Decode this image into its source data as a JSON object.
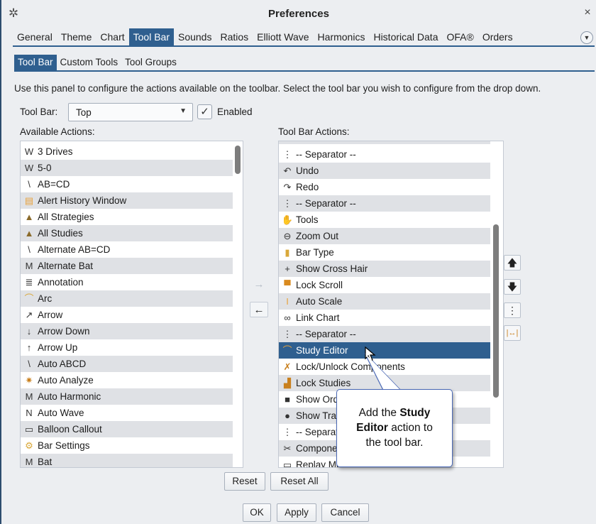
{
  "window": {
    "title": "Preferences",
    "gear_icon": "gear-icon",
    "close_glyph": "×"
  },
  "tabs": [
    {
      "label": "General"
    },
    {
      "label": "Theme"
    },
    {
      "label": "Chart"
    },
    {
      "label": "Tool Bar",
      "active": true
    },
    {
      "label": "Sounds"
    },
    {
      "label": "Ratios"
    },
    {
      "label": "Elliott Wave"
    },
    {
      "label": "Harmonics"
    },
    {
      "label": "Historical Data"
    },
    {
      "label": "OFA®"
    },
    {
      "label": "Orders"
    }
  ],
  "subtabs": [
    {
      "label": "Tool Bar",
      "active": true
    },
    {
      "label": "Custom Tools"
    },
    {
      "label": "Tool Groups"
    }
  ],
  "description": "Use this panel to configure the actions available on the toolbar.  Select the tool bar you wish to configure from the drop down.",
  "toolbar_select": {
    "label": "Tool Bar:",
    "value": "Top",
    "enabled_checked": true,
    "enabled_label": "Enabled"
  },
  "available": {
    "header": "Available Actions:",
    "items": [
      {
        "label": "3 Drives",
        "icon": "wave-icon"
      },
      {
        "label": "5-0",
        "icon": "wave-icon"
      },
      {
        "label": "AB=CD",
        "icon": "zigzag-icon"
      },
      {
        "label": "Alert History Window",
        "icon": "alert-history-icon"
      },
      {
        "label": "All Strategies",
        "icon": "chart-area-icon"
      },
      {
        "label": "All Studies",
        "icon": "chart-area-icon"
      },
      {
        "label": "Alternate AB=CD",
        "icon": "zigzag-icon"
      },
      {
        "label": "Alternate Bat",
        "icon": "bat-pattern-icon"
      },
      {
        "label": "Annotation",
        "icon": "annotation-icon"
      },
      {
        "label": "Arc",
        "icon": "arc-icon"
      },
      {
        "label": "Arrow",
        "icon": "arrow-icon"
      },
      {
        "label": "Arrow Down",
        "icon": "arrow-down-icon"
      },
      {
        "label": "Arrow Up",
        "icon": "arrow-up-icon"
      },
      {
        "label": "Auto ABCD",
        "icon": "zigzag-icon"
      },
      {
        "label": "Auto Analyze",
        "icon": "auto-analyze-icon"
      },
      {
        "label": "Auto Harmonic",
        "icon": "harmonic-icon"
      },
      {
        "label": "Auto Wave",
        "icon": "auto-wave-icon"
      },
      {
        "label": "Balloon Callout",
        "icon": "speech-balloon-icon"
      },
      {
        "label": "Bar Settings",
        "icon": "bar-settings-icon"
      },
      {
        "label": "Bat",
        "icon": "bat-pattern-icon"
      }
    ]
  },
  "toolbar_actions": {
    "header": "Tool Bar Actions:",
    "items": [
      {
        "label": "-- Separator --",
        "icon": "separator-icon"
      },
      {
        "label": "Undo",
        "icon": "undo-icon"
      },
      {
        "label": "Redo",
        "icon": "redo-icon"
      },
      {
        "label": "-- Separator --",
        "icon": "separator-icon"
      },
      {
        "label": "Tools",
        "icon": "hand-icon"
      },
      {
        "label": "Zoom Out",
        "icon": "zoom-out-icon"
      },
      {
        "label": "Bar Type",
        "icon": "candlestick-icon"
      },
      {
        "label": "Show Cross Hair",
        "icon": "crosshair-icon"
      },
      {
        "label": "Lock Scroll",
        "icon": "lock-scroll-icon"
      },
      {
        "label": "Auto Scale",
        "icon": "auto-scale-icon"
      },
      {
        "label": "Link Chart",
        "icon": "link-icon"
      },
      {
        "label": "-- Separator --",
        "icon": "separator-icon"
      },
      {
        "label": "Study Editor",
        "icon": "study-editor-icon",
        "selected": true
      },
      {
        "label": "Lock/Unlock Components",
        "icon": "lock-unlock-icon"
      },
      {
        "label": "Lock Studies",
        "icon": "lock-studies-icon"
      },
      {
        "label": "Show Order",
        "icon": "show-order-icon"
      },
      {
        "label": "Show Trades",
        "icon": "show-trades-icon"
      },
      {
        "label": "-- Separator --",
        "icon": "separator-icon"
      },
      {
        "label": "Components",
        "icon": "tools-icon"
      },
      {
        "label": "Replay Mode",
        "icon": "replay-icon"
      }
    ]
  },
  "move_buttons": {
    "add": "→",
    "remove": "←"
  },
  "side_buttons": {
    "up": "🡅",
    "down": "🡇",
    "separator": "⋮",
    "spacer": "|↔|"
  },
  "buttons": {
    "reset": "Reset",
    "reset_all": "Reset All",
    "ok": "OK",
    "apply": "Apply",
    "cancel": "Cancel"
  },
  "callout": {
    "line1_prefix": "Add the ",
    "line1_bold": "Study",
    "line2_bold": "Editor",
    "line2_suffix": " action to",
    "line3": "the tool bar."
  },
  "colors": {
    "accent": "#2f5f8f",
    "callout_border": "#4a68b5"
  }
}
